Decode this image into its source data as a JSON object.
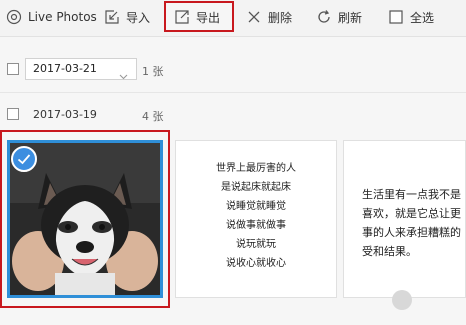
{
  "toolbar": {
    "live_photos": "Live Photos",
    "import": "导入",
    "export": "导出",
    "delete": "删除",
    "refresh": "刷新",
    "select_all": "全选"
  },
  "groups": [
    {
      "date": "2017-03-21",
      "count": "1 张"
    },
    {
      "date": "2017-03-19",
      "count": "4 张"
    }
  ],
  "text_card_1": {
    "lines": [
      "世界上最厉害的人",
      "是说起床就起床",
      "说睡觉就睡觉",
      "说做事就做事",
      "说玩就玩",
      "说收心就收心"
    ]
  },
  "text_card_2": {
    "lines": [
      "生活里有一点我不是",
      "喜欢，就是它总让更",
      "事的人来承担糟糕的",
      "受和结果。"
    ]
  },
  "icons": {
    "live_photos": "live-photos-icon",
    "import": "import-icon",
    "export": "export-icon",
    "delete": "delete-icon",
    "refresh": "refresh-icon",
    "select_all": "checkbox-icon"
  },
  "colors": {
    "highlight": "#c8181e",
    "selection_blue": "#2f8fd8"
  }
}
